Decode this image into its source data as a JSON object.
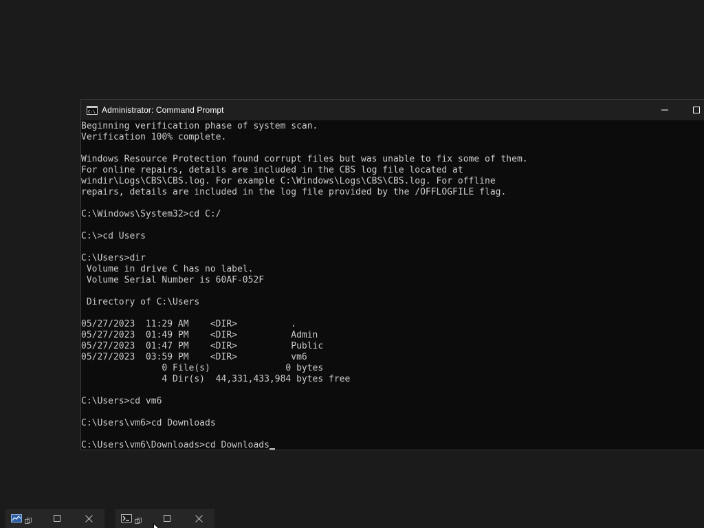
{
  "window": {
    "title": "Administrator: Command Prompt",
    "icon": "cmd-icon",
    "controls": [
      "minimize-icon",
      "maximize-icon"
    ]
  },
  "console": {
    "lines": [
      "Beginning verification phase of system scan.",
      "Verification 100% complete.",
      "",
      "Windows Resource Protection found corrupt files but was unable to fix some of them.",
      "For online repairs, details are included in the CBS log file located at",
      "windir\\Logs\\CBS\\CBS.log. For example C:\\Windows\\Logs\\CBS\\CBS.log. For offline",
      "repairs, details are included in the log file provided by the /OFFLOGFILE flag.",
      "",
      "C:\\Windows\\System32>cd C:/",
      "",
      "C:\\>cd Users",
      "",
      "C:\\Users>dir",
      " Volume in drive C has no label.",
      " Volume Serial Number is 60AF-052F",
      "",
      " Directory of C:\\Users",
      "",
      "05/27/2023  11:29 AM    <DIR>          .",
      "05/27/2023  01:49 PM    <DIR>          Admin",
      "05/27/2023  01:47 PM    <DIR>          Public",
      "05/27/2023  03:59 PM    <DIR>          vm6",
      "               0 File(s)              0 bytes",
      "               4 Dir(s)  44,331,433,984 bytes free",
      "",
      "C:\\Users>cd vm6",
      "",
      "C:\\Users\\vm6>cd Downloads",
      "",
      "C:\\Users\\vm6\\Downloads>cd Downloads"
    ]
  },
  "taskbar": {
    "items": [
      {
        "app_icon": "task-manager-icon",
        "snap_icon": "snap-layout-icon",
        "max_icon": "maximize-icon",
        "close_icon": "close-icon"
      },
      {
        "app_icon": "terminal-icon",
        "snap_icon": "snap-layout-icon",
        "max_icon": "maximize-icon",
        "close_icon": "close-icon"
      }
    ]
  },
  "colors": {
    "desktop": "#1b1b1b",
    "console_bg": "#0c0c0c",
    "console_text": "#cccccc",
    "titlebar": "#1f1f1f"
  }
}
